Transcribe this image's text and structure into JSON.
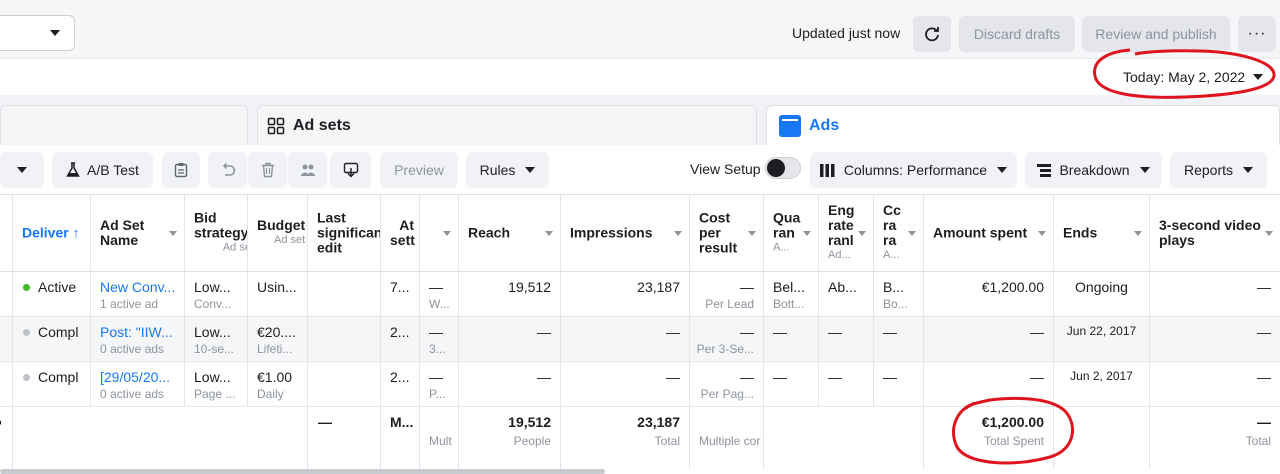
{
  "topbar": {
    "updated_text": "Updated just now",
    "discard_label": "Discard drafts",
    "review_label": "Review and publish",
    "more_label": "···"
  },
  "date_picker": {
    "label": "Today: May 2, 2022"
  },
  "tabs": [
    {
      "label": ""
    },
    {
      "label": "Ad sets"
    },
    {
      "label": "Ads"
    }
  ],
  "toolbar": {
    "ab_test": "A/B Test",
    "preview": "Preview",
    "rules": "Rules",
    "view_setup": "View Setup",
    "columns": "Columns: Performance",
    "breakdown": "Breakdown",
    "reports": "Reports"
  },
  "table": {
    "headers": {
      "delivery": "Deliver ↑",
      "ad_set_name": "Ad Set Name",
      "bid_strategy": "Bid strategy",
      "bid_strategy_sub": "Ad set",
      "budget": "Budget",
      "budget_sub": "Ad set",
      "last_edit": "Last significant edit",
      "attribution": "At sett",
      "reach": "Reach",
      "impressions": "Impressions",
      "cost_per_result": "Cost per result",
      "quality": "Qua ran",
      "quality_sub": "A...",
      "engagement": "Eng rate ranl",
      "engagement_sub": "Ad...",
      "conversion": "Cc ra ra",
      "conversion_sub": "A...",
      "amount_spent": "Amount spent",
      "ends": "Ends",
      "video_plays": "3-second video plays"
    },
    "rows": [
      {
        "status": "Active",
        "status_color": "#42b72a",
        "name": "New Conv...",
        "name_sub": "1 active ad",
        "bid": "Low...",
        "bid_sub": "Conv...",
        "budget": "Usin...",
        "budget_sub": "",
        "attr": "7...",
        "results": "—",
        "results_sub": "W...",
        "reach": "19,512",
        "impressions": "23,187",
        "cpr": "—",
        "cpr_sub": "Per Lead",
        "quality": "Bel...",
        "quality_sub": "Bott...",
        "engagement": "Ab...",
        "conversion": "B...",
        "conversion_sub": "Bo...",
        "spent": "€1,200.00",
        "ends": "Ongoing",
        "video": "—"
      },
      {
        "status": "Compl",
        "status_color": "#bec3c9",
        "name": "Post: \"IIW...",
        "name_sub": "0 active ads",
        "bid": "Low...",
        "bid_sub": "10-se...",
        "budget": "€20....",
        "budget_sub": "Lifeti...",
        "attr": "2...",
        "results": "—",
        "results_sub": "3...",
        "reach": "—",
        "impressions": "—",
        "cpr": "—",
        "cpr_sub": "Per 3-Se...",
        "quality": "—",
        "quality_sub": "",
        "engagement": "—",
        "conversion": "—",
        "conversion_sub": "",
        "spent": "—",
        "ends": "Jun 22, 2017",
        "video": "—"
      },
      {
        "status": "Compl",
        "status_color": "#bec3c9",
        "name": "[29/05/20...",
        "name_sub": "0 active ads",
        "bid": "Low...",
        "bid_sub": "Page ...",
        "budget": "€1.00",
        "budget_sub": "Daily",
        "attr": "2...",
        "results": "—",
        "results_sub": "P...",
        "reach": "—",
        "impressions": "—",
        "cpr": "—",
        "cpr_sub": "Per Pag...",
        "quality": "—",
        "quality_sub": "",
        "engagement": "—",
        "conversion": "—",
        "conversion_sub": "",
        "spent": "—",
        "ends": "Jun 2, 2017",
        "video": "—"
      }
    ],
    "totals": {
      "last_edit": "—",
      "attr": "M...",
      "results_sub": "Mult",
      "reach": "19,512",
      "reach_sub": "People",
      "impressions": "23,187",
      "impressions_sub": "Total",
      "cpr_sub": "Multiple cor",
      "spent": "€1,200.00",
      "spent_sub": "Total Spent",
      "video": "—",
      "video_sub": "Total"
    }
  },
  "colors": {
    "accent": "#1877f2",
    "annotation": "#e0141e"
  }
}
